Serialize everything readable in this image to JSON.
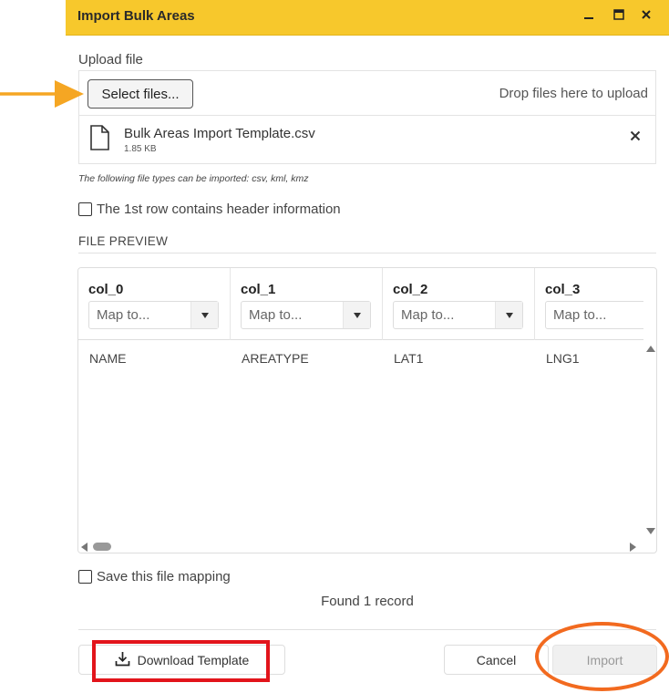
{
  "dialog": {
    "title": "Import Bulk Areas",
    "window_controls": [
      "minimize-icon",
      "maximize-icon",
      "close-icon"
    ]
  },
  "upload": {
    "section_label": "Upload file",
    "select_button": "Select files...",
    "drop_hint": "Drop files here to upload",
    "file": {
      "name": "Bulk Areas Import Template.csv",
      "size": "1.85 KB",
      "icon": "file-icon"
    },
    "allowed_types": "The following file types can be imported: csv, kml, kmz"
  },
  "header_row_checkbox": {
    "label": "The 1st row contains header information",
    "checked": false
  },
  "preview": {
    "title": "FILE PREVIEW",
    "columns": [
      {
        "name": "col_0",
        "placeholder": "Map to...",
        "value": "NAME"
      },
      {
        "name": "col_1",
        "placeholder": "Map to...",
        "value": "AREATYPE"
      },
      {
        "name": "col_2",
        "placeholder": "Map to...",
        "value": "LAT1"
      },
      {
        "name": "col_3",
        "placeholder": "Map to...",
        "value": "LNG1"
      }
    ]
  },
  "save_mapping_checkbox": {
    "label": "Save this file mapping",
    "checked": false
  },
  "status": "Found 1 record",
  "footer": {
    "download_template": "Download Template",
    "cancel": "Cancel",
    "import": "Import"
  },
  "colors": {
    "titlebar": "#f7c82c",
    "annotation_arrow": "#f5a623",
    "annotation_red": "#e2141b",
    "annotation_orange": "#f26a1f"
  }
}
